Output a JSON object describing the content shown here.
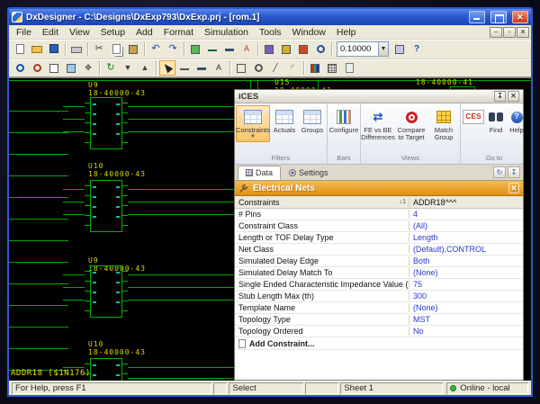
{
  "window": {
    "title": "DxDesigner - C:\\Designs\\DxExp793\\DxExp.prj - [rom.1]"
  },
  "menu": {
    "items": [
      "File",
      "Edit",
      "View",
      "Setup",
      "Add",
      "Format",
      "Simulation",
      "Tools",
      "Window",
      "Help"
    ]
  },
  "toolbar1": {
    "icons": [
      "new",
      "open",
      "save",
      "print",
      "cut",
      "copy",
      "paste",
      "undo",
      "redo",
      "add-part",
      "add-wire",
      "add-bus",
      "add-net-name",
      "dxdatabook",
      "navigator",
      "ces",
      "find",
      "properties",
      "zoom-mode",
      "help"
    ],
    "zoom_value": "0.10000"
  },
  "toolbar2": {
    "icons": [
      "zoom-in",
      "zoom-out",
      "zoom-window",
      "zoom-full",
      "pan",
      "redraw",
      "push-into",
      "pop-out",
      "select",
      "wire-tool",
      "bus-tool",
      "text-tool",
      "rect-tool",
      "circle-tool",
      "line-tool",
      "arc-tool",
      "color-picker",
      "grid-toggle",
      "sheet-settings"
    ]
  },
  "canvas": {
    "components": [
      {
        "ref": "U9",
        "part": "18-40000-43"
      },
      {
        "ref": "U10",
        "part": "18-40000-43"
      },
      {
        "ref": "U9",
        "part": "18-40000-43"
      },
      {
        "ref": "U10",
        "part": "18-40000-43"
      },
      {
        "ref": "U15",
        "part": "18-40000-41"
      }
    ],
    "top_right_part": "18-40000-41",
    "net_label": "ADDR18 ($1N176)"
  },
  "ices": {
    "title": "iCES",
    "ribbon": {
      "groups": [
        {
          "caption": "Filters",
          "buttons": [
            {
              "label": "Constraints"
            },
            {
              "label": "Actuals"
            },
            {
              "label": "Groups"
            }
          ]
        },
        {
          "caption": "Bars",
          "buttons": [
            {
              "label": "Configure"
            }
          ]
        },
        {
          "caption": "Views",
          "buttons": [
            {
              "label": "FE vs BE Differences"
            },
            {
              "label": "Compare to Target"
            },
            {
              "label": "Match Group"
            }
          ]
        },
        {
          "caption": "Go to",
          "buttons": [
            {
              "label": "CES"
            },
            {
              "label": "Find"
            },
            {
              "label": "Help"
            }
          ]
        }
      ]
    },
    "tabs": [
      {
        "label": "Data"
      },
      {
        "label": "Settings"
      }
    ],
    "panel": {
      "title": "Electrical Nets",
      "columns": {
        "name": "Constraints",
        "sort_badge": "↓1",
        "value": "ADDR18^^^"
      },
      "rows": [
        {
          "name": "# Pins",
          "value": "4"
        },
        {
          "name": "Constraint Class",
          "value": "(All)"
        },
        {
          "name": "Length or TOF Delay Type",
          "value": "Length"
        },
        {
          "name": "Net Class",
          "value": "(Default),CONTROL"
        },
        {
          "name": "Simulated Delay Edge",
          "value": "Both"
        },
        {
          "name": "Simulated Delay Match To",
          "value": "(None)"
        },
        {
          "name": "Single Ended Characteristic Impedance Value (Ohm)",
          "value": "75"
        },
        {
          "name": "Stub Length Max (th)",
          "value": "300"
        },
        {
          "name": "Template Name",
          "value": "(None)"
        },
        {
          "name": "Topology Type",
          "value": "MST"
        },
        {
          "name": "Topology Ordered",
          "value": "No"
        }
      ],
      "add_row_label": "Add Constraint..."
    }
  },
  "statusbar": {
    "help": "For Help, press F1",
    "mode": "Select",
    "sheet": "Sheet 1",
    "online": "Online - local"
  }
}
